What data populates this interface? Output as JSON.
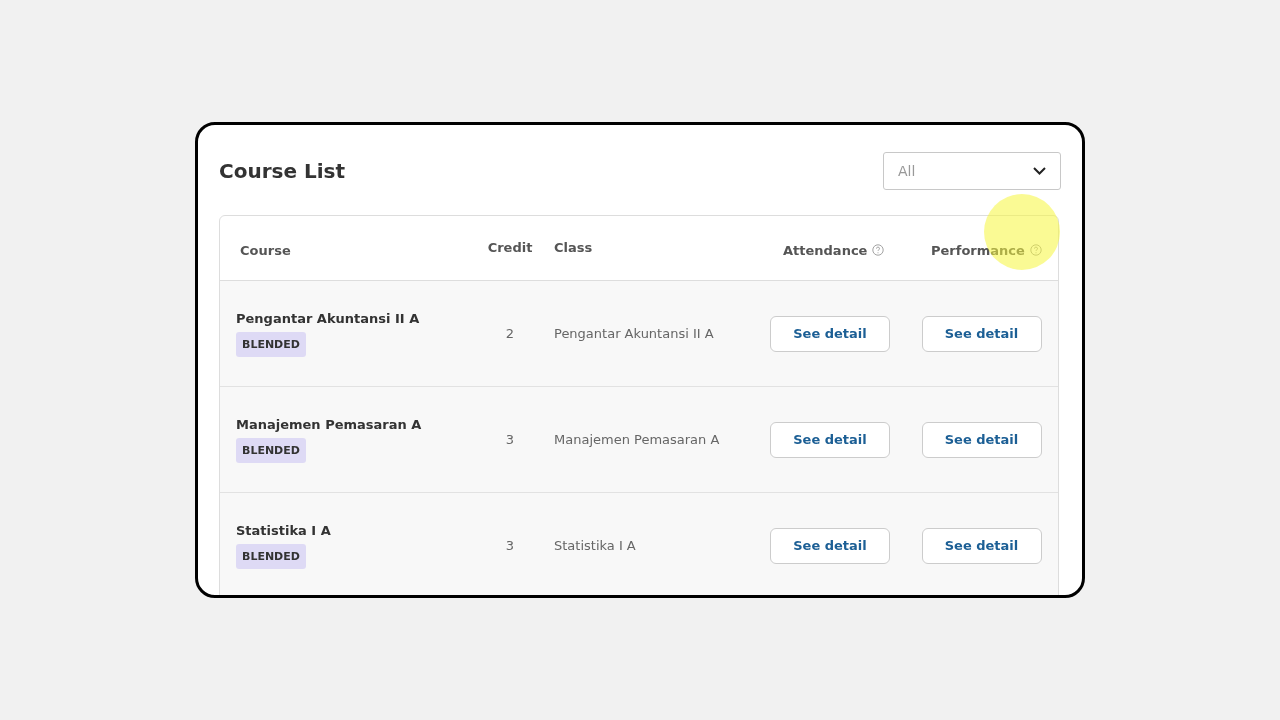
{
  "title": "Course List",
  "filter": {
    "value": "All"
  },
  "table": {
    "columns": [
      {
        "label": "Course",
        "help": false
      },
      {
        "label": "Credit",
        "help": false
      },
      {
        "label": "Class",
        "help": false
      },
      {
        "label": "Attendance",
        "help": true
      },
      {
        "label": "Performance",
        "help": true
      }
    ],
    "rows": [
      {
        "course": "Pengantar Akuntansi II A",
        "tag": "BLENDED",
        "credit": "2",
        "class": "Pengantar Akuntansi II A",
        "attendance": "See detail",
        "performance": "See detail"
      },
      {
        "course": "Manajemen Pemasaran A",
        "tag": "BLENDED",
        "credit": "3",
        "class": "Manajemen Pemasaran A",
        "attendance": "See detail",
        "performance": "See detail"
      },
      {
        "course": "Statistika I A",
        "tag": "BLENDED",
        "credit": "3",
        "class": "Statistika I A",
        "attendance": "See detail",
        "performance": "See detail"
      }
    ]
  }
}
